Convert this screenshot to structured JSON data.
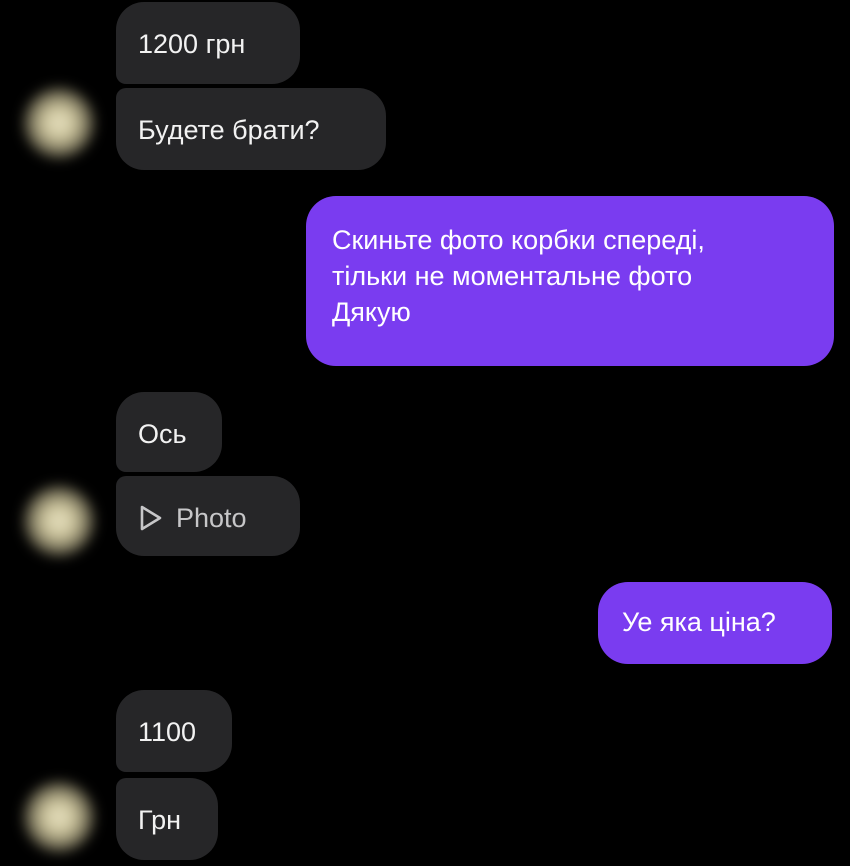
{
  "messages": [
    {
      "id": "m1",
      "direction": "incoming",
      "text": "1200 грн"
    },
    {
      "id": "m2",
      "direction": "incoming",
      "text": "Будете брати?"
    },
    {
      "id": "m3",
      "direction": "outgoing",
      "lines": [
        "Скиньте фото корбки спереді,",
        "тільки не моментальне фото",
        "Дякую"
      ]
    },
    {
      "id": "m4",
      "direction": "incoming",
      "text": "Ось"
    },
    {
      "id": "m5",
      "direction": "incoming",
      "type": "photo",
      "text": "Photo",
      "icon": "play-icon"
    },
    {
      "id": "m6",
      "direction": "outgoing",
      "text": "Уе яка ціна?"
    },
    {
      "id": "m7",
      "direction": "incoming",
      "text": "1100"
    },
    {
      "id": "m8",
      "direction": "incoming",
      "text": "Грн"
    }
  ],
  "colors": {
    "background": "#000000",
    "incoming_bubble": "#262628",
    "outgoing_bubble": "#7a3cf0",
    "text": "#ffffff"
  }
}
